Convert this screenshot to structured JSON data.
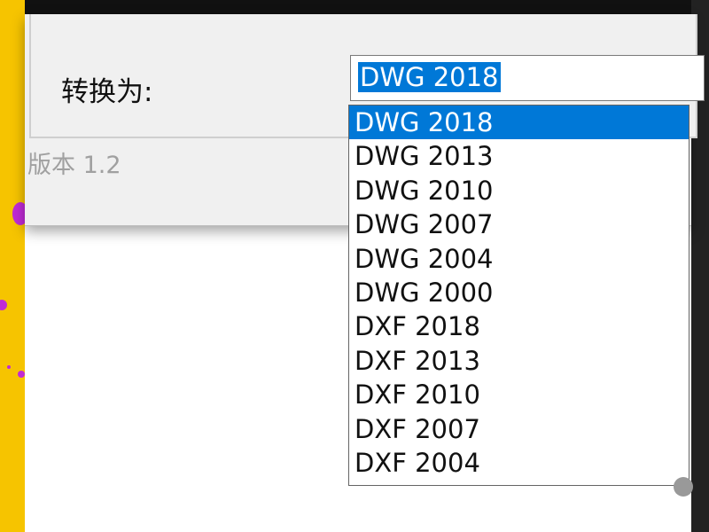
{
  "window": {
    "convert_label": "转换为:",
    "version_label": "版本 1.2"
  },
  "combo": {
    "selected_value": "DWG 2018"
  },
  "dropdown": {
    "options": [
      {
        "label": "DWG 2018",
        "selected": true
      },
      {
        "label": "DWG 2013",
        "selected": false
      },
      {
        "label": "DWG 2010",
        "selected": false
      },
      {
        "label": "DWG 2007",
        "selected": false
      },
      {
        "label": "DWG 2004",
        "selected": false
      },
      {
        "label": "DWG 2000",
        "selected": false
      },
      {
        "label": "DXF 2018",
        "selected": false
      },
      {
        "label": "DXF 2013",
        "selected": false
      },
      {
        "label": "DXF 2010",
        "selected": false
      },
      {
        "label": "DXF 2007",
        "selected": false
      },
      {
        "label": "DXF 2004",
        "selected": false
      }
    ]
  },
  "colors": {
    "selection": "#0078d7",
    "desktop_strip": "#f6c400",
    "accent_dots": "#c02bd6"
  }
}
